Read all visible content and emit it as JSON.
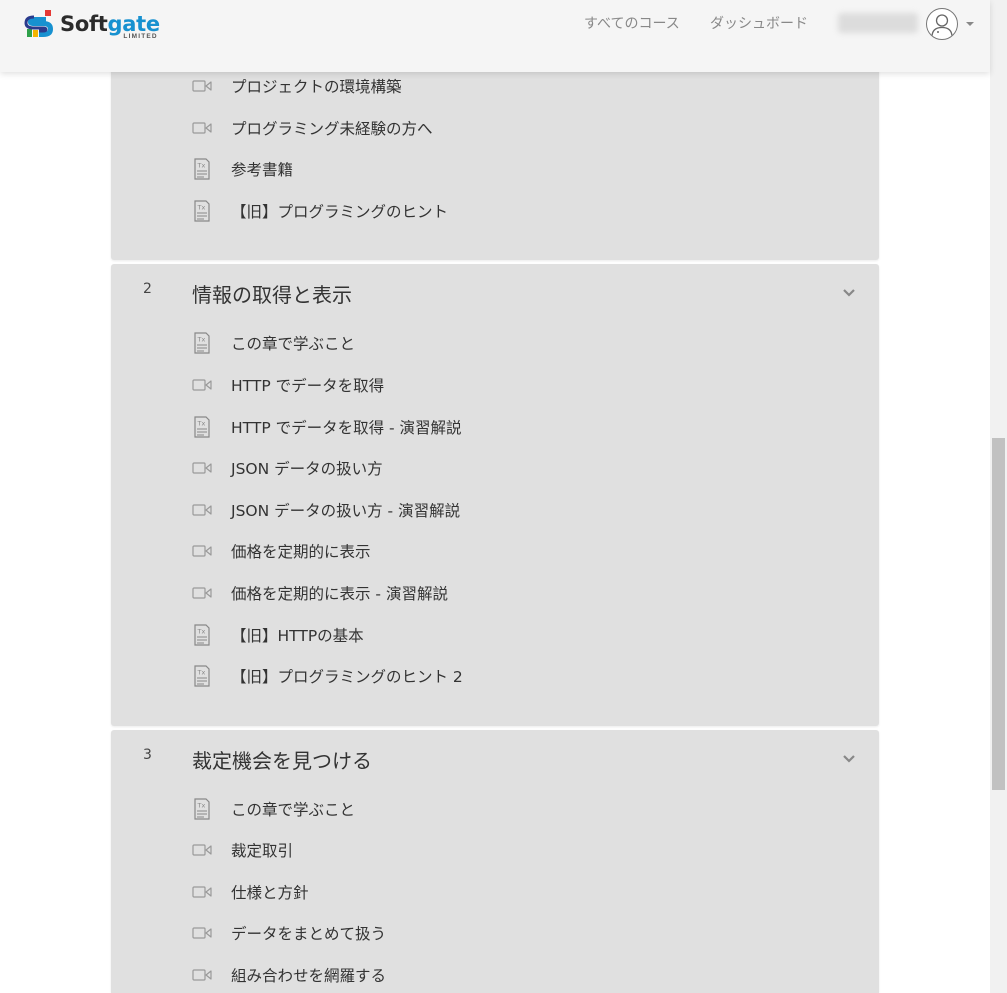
{
  "header": {
    "logo": {
      "name_part1": "Soft",
      "name_part2": "gate",
      "sub": "LIMITED"
    },
    "nav": [
      {
        "label": "すべてのコース"
      },
      {
        "label": "ダッシュボード"
      }
    ]
  },
  "colors": {
    "logo_accent": "#1791d0",
    "section_bg": "#e0e0e0",
    "header_bg": "#f5f5f5"
  },
  "sections": [
    {
      "number": "",
      "title": "",
      "lessons": [
        {
          "type": "video",
          "icon": "video-icon",
          "label": "プロジェクトの環境構築"
        },
        {
          "type": "video",
          "icon": "video-icon",
          "label": "プログラミング未経験の方へ"
        },
        {
          "type": "text",
          "icon": "text-document-icon",
          "label": "参考書籍"
        },
        {
          "type": "text",
          "icon": "text-document-icon",
          "label": "【旧】プログラミングのヒント"
        }
      ]
    },
    {
      "number": "2",
      "title": "情報の取得と表示",
      "lessons": [
        {
          "type": "text",
          "icon": "text-document-icon",
          "label": "この章で学ぶこと"
        },
        {
          "type": "video",
          "icon": "video-icon",
          "label": "HTTP でデータを取得"
        },
        {
          "type": "text",
          "icon": "text-document-icon",
          "label": "HTTP でデータを取得 - 演習解説"
        },
        {
          "type": "video",
          "icon": "video-icon",
          "label": "JSON データの扱い方"
        },
        {
          "type": "video",
          "icon": "video-icon",
          "label": "JSON データの扱い方 - 演習解説"
        },
        {
          "type": "video",
          "icon": "video-icon",
          "label": "価格を定期的に表示"
        },
        {
          "type": "video",
          "icon": "video-icon",
          "label": "価格を定期的に表示 - 演習解説"
        },
        {
          "type": "text",
          "icon": "text-document-icon",
          "label": "【旧】HTTPの基本"
        },
        {
          "type": "text",
          "icon": "text-document-icon",
          "label": "【旧】プログラミングのヒント 2"
        }
      ]
    },
    {
      "number": "3",
      "title": "裁定機会を見つける",
      "lessons": [
        {
          "type": "text",
          "icon": "text-document-icon",
          "label": "この章で学ぶこと"
        },
        {
          "type": "video",
          "icon": "video-icon",
          "label": "裁定取引"
        },
        {
          "type": "video",
          "icon": "video-icon",
          "label": "仕様と方針"
        },
        {
          "type": "video",
          "icon": "video-icon",
          "label": "データをまとめて扱う"
        },
        {
          "type": "video",
          "icon": "video-icon",
          "label": "組み合わせを網羅する"
        }
      ]
    }
  ]
}
